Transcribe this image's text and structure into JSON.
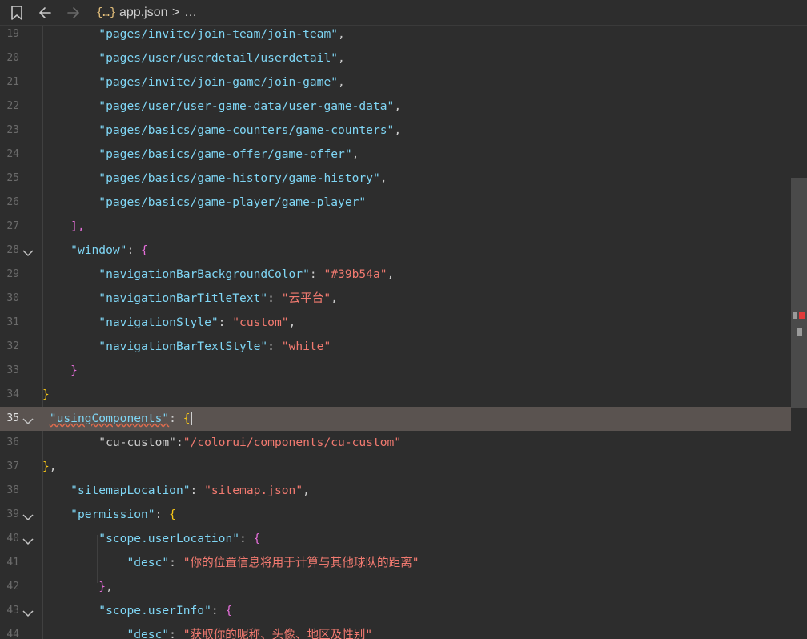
{
  "titlebar": {
    "file_icon": "{…}",
    "filename": "app.json",
    "separator": ">",
    "ellipsis": "…",
    "icons": [
      "bookmark-icon",
      "back-arrow-icon",
      "forward-arrow-icon"
    ]
  },
  "colors": {
    "key": "#7fd6f5",
    "string": "#f27a70",
    "punct": "#cccccc",
    "brace_level1": "#f5c518",
    "brace_level2": "#e36ed8",
    "highlight": "#5a5350"
  },
  "editor": {
    "active_line": "35",
    "lines": [
      {
        "n": "19",
        "i1": "        ",
        "t1": "\"pages/invite/join-team/join-team\"",
        "t2": ","
      },
      {
        "n": "20",
        "i1": "        ",
        "t1": "\"pages/user/userdetail/userdetail\"",
        "t2": ","
      },
      {
        "n": "21",
        "i1": "        ",
        "t1": "\"pages/invite/join-game/join-game\"",
        "t2": ","
      },
      {
        "n": "22",
        "i1": "        ",
        "t1": "\"pages/user/user-game-data/user-game-data\"",
        "t2": ","
      },
      {
        "n": "23",
        "i1": "        ",
        "t1": "\"pages/basics/game-counters/game-counters\"",
        "t2": ","
      },
      {
        "n": "24",
        "i1": "        ",
        "t1": "\"pages/basics/game-offer/game-offer\"",
        "t2": ","
      },
      {
        "n": "25",
        "i1": "        ",
        "t1": "\"pages/basics/game-history/game-history\"",
        "t2": ","
      },
      {
        "n": "26",
        "i1": "        ",
        "t1": "\"pages/basics/game-player/game-player\""
      },
      {
        "n": "27",
        "i1": "    ",
        "t1": "],"
      },
      {
        "n": "28",
        "i1": "    ",
        "t1": "\"window\"",
        "t2": ": ",
        "t3": "{"
      },
      {
        "n": "29",
        "i1": "        ",
        "t1": "\"navigationBarBackgroundColor\"",
        "t2": ": ",
        "t3": "\"#39b54a\"",
        "t4": ","
      },
      {
        "n": "30",
        "i1": "        ",
        "t1": "\"navigationBarTitleText\"",
        "t2": ": ",
        "t3": "\"云平台\"",
        "t4": ","
      },
      {
        "n": "31",
        "i1": "        ",
        "t1": "\"navigationStyle\"",
        "t2": ": ",
        "t3": "\"custom\"",
        "t4": ","
      },
      {
        "n": "32",
        "i1": "        ",
        "t1": "\"navigationBarTextStyle\"",
        "t2": ": ",
        "t3": "\"white\""
      },
      {
        "n": "33",
        "i1": "    ",
        "t1": "}"
      },
      {
        "n": "34",
        "t1": "}"
      },
      {
        "n": "35",
        "i1": " ",
        "t1": "\"usingComponents\"",
        "t2": ": ",
        "t3": "{"
      },
      {
        "n": "36",
        "i1": "        ",
        "t1": "\"cu-custom\"",
        "t2": ":",
        "t3": "\"/colorui/components/cu-custom\""
      },
      {
        "n": "37",
        "t1": "}",
        "t2": ","
      },
      {
        "n": "38",
        "i1": "    ",
        "t1": "\"sitemapLocation\"",
        "t2": ": ",
        "t3": "\"sitemap.json\"",
        "t4": ","
      },
      {
        "n": "39",
        "i1": "    ",
        "t1": "\"permission\"",
        "t2": ": ",
        "t3": "{"
      },
      {
        "n": "40",
        "i1": "        ",
        "t1": "\"scope.userLocation\"",
        "t2": ": ",
        "t3": "{"
      },
      {
        "n": "41",
        "i1": "            ",
        "t1": "\"desc\"",
        "t2": ": ",
        "t3": "\"你的位置信息将用于计算与其他球队的距离\""
      },
      {
        "n": "42",
        "i1": "        ",
        "t1": "}",
        "t2": ","
      },
      {
        "n": "43",
        "i1": "        ",
        "t1": "\"scope.userInfo\"",
        "t2": ": ",
        "t3": "{"
      },
      {
        "n": "44",
        "i1": "            ",
        "t1": "\"desc\"",
        "t2": ": ",
        "t3": "\"获取你的昵称、头像、地区及性别\""
      }
    ]
  }
}
